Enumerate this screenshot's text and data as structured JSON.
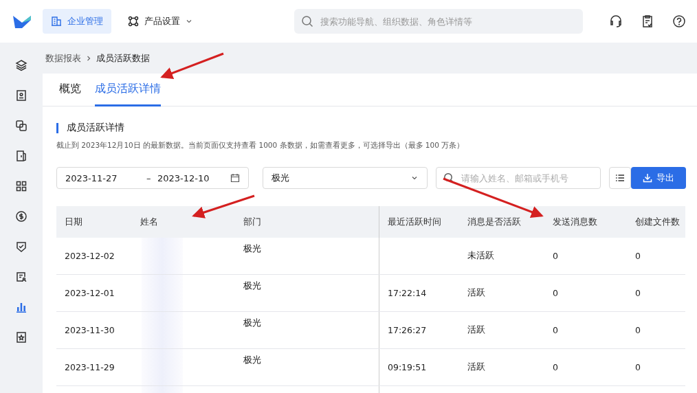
{
  "topbar": {
    "nav": [
      {
        "label": "企业管理",
        "selected": true,
        "kind": "building"
      },
      {
        "label": "产品设置",
        "selected": false,
        "kind": "settings"
      }
    ],
    "search": {
      "placeholder": "搜索功能导航、组织数据、角色详情等"
    }
  },
  "sidebar": {
    "items": [
      {
        "kind": "layers",
        "selected": false
      },
      {
        "kind": "contacts",
        "selected": false
      },
      {
        "kind": "copy",
        "selected": false
      },
      {
        "kind": "door",
        "selected": false
      },
      {
        "kind": "grid",
        "selected": false
      },
      {
        "kind": "dollar",
        "selected": false
      },
      {
        "kind": "shield",
        "selected": false
      },
      {
        "kind": "form",
        "selected": false
      },
      {
        "kind": "chart",
        "selected": true
      },
      {
        "kind": "star",
        "selected": false
      }
    ]
  },
  "breadcrumb": [
    "数据报表",
    "成员活跃数据"
  ],
  "tabs": [
    {
      "label": "概览",
      "selected": false
    },
    {
      "label": "成员活跃详情",
      "selected": true
    }
  ],
  "section": {
    "title": "成员活跃详情",
    "note": "截止到 2023年12月10日 的最新数据。当前页面仅支持查看 1000 条数据，如需查看更多，可选择导出（最多 100 万条）"
  },
  "filters": {
    "date_start": "2023-11-27",
    "date_separator": "–",
    "date_end": "2023-12-10",
    "department": "极光",
    "search_placeholder": "请输入姓名、邮箱或手机号",
    "export_label": "导出"
  },
  "table": {
    "columns": [
      "日期",
      "姓名",
      "部门",
      "最近活跃时间",
      "消息是否活跃",
      "发送消息数",
      "创建文件数"
    ],
    "rows": [
      {
        "date": "2023-12-02",
        "department": "极光",
        "last_active": "",
        "message_active": "未活跃",
        "messages_sent": "0",
        "files_created": "0"
      },
      {
        "date": "2023-12-01",
        "department": "极光",
        "last_active": "17:22:14",
        "message_active": "活跃",
        "messages_sent": "0",
        "files_created": "0"
      },
      {
        "date": "2023-11-30",
        "department": "极光",
        "last_active": "17:26:27",
        "message_active": "活跃",
        "messages_sent": "0",
        "files_created": "0"
      },
      {
        "date": "2023-11-29",
        "department": "极光",
        "last_active": "09:19:51",
        "message_active": "活跃",
        "messages_sent": "0",
        "files_created": "0"
      }
    ]
  }
}
